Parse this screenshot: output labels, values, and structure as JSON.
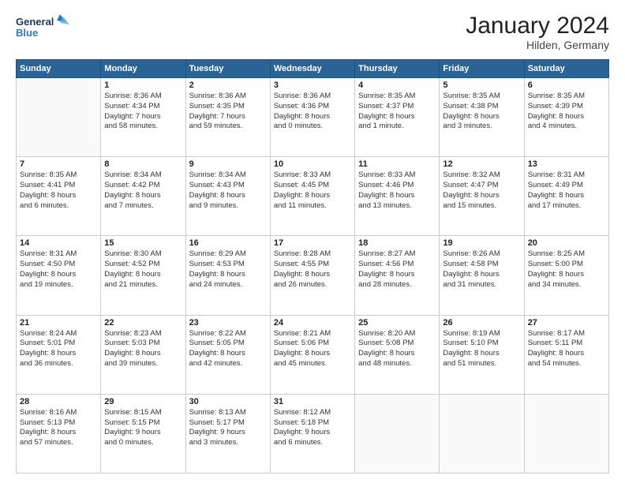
{
  "header": {
    "logo_line1": "General",
    "logo_line2": "Blue",
    "title": "January 2024",
    "subtitle": "Hilden, Germany"
  },
  "days_of_week": [
    "Sunday",
    "Monday",
    "Tuesday",
    "Wednesday",
    "Thursday",
    "Friday",
    "Saturday"
  ],
  "weeks": [
    [
      {
        "day": "",
        "info": ""
      },
      {
        "day": "1",
        "info": "Sunrise: 8:36 AM\nSunset: 4:34 PM\nDaylight: 7 hours\nand 58 minutes."
      },
      {
        "day": "2",
        "info": "Sunrise: 8:36 AM\nSunset: 4:35 PM\nDaylight: 7 hours\nand 59 minutes."
      },
      {
        "day": "3",
        "info": "Sunrise: 8:36 AM\nSunset: 4:36 PM\nDaylight: 8 hours\nand 0 minutes."
      },
      {
        "day": "4",
        "info": "Sunrise: 8:35 AM\nSunset: 4:37 PM\nDaylight: 8 hours\nand 1 minute."
      },
      {
        "day": "5",
        "info": "Sunrise: 8:35 AM\nSunset: 4:38 PM\nDaylight: 8 hours\nand 3 minutes."
      },
      {
        "day": "6",
        "info": "Sunrise: 8:35 AM\nSunset: 4:39 PM\nDaylight: 8 hours\nand 4 minutes."
      }
    ],
    [
      {
        "day": "7",
        "info": "Sunrise: 8:35 AM\nSunset: 4:41 PM\nDaylight: 8 hours\nand 6 minutes."
      },
      {
        "day": "8",
        "info": "Sunrise: 8:34 AM\nSunset: 4:42 PM\nDaylight: 8 hours\nand 7 minutes."
      },
      {
        "day": "9",
        "info": "Sunrise: 8:34 AM\nSunset: 4:43 PM\nDaylight: 8 hours\nand 9 minutes."
      },
      {
        "day": "10",
        "info": "Sunrise: 8:33 AM\nSunset: 4:45 PM\nDaylight: 8 hours\nand 11 minutes."
      },
      {
        "day": "11",
        "info": "Sunrise: 8:33 AM\nSunset: 4:46 PM\nDaylight: 8 hours\nand 13 minutes."
      },
      {
        "day": "12",
        "info": "Sunrise: 8:32 AM\nSunset: 4:47 PM\nDaylight: 8 hours\nand 15 minutes."
      },
      {
        "day": "13",
        "info": "Sunrise: 8:31 AM\nSunset: 4:49 PM\nDaylight: 8 hours\nand 17 minutes."
      }
    ],
    [
      {
        "day": "14",
        "info": "Sunrise: 8:31 AM\nSunset: 4:50 PM\nDaylight: 8 hours\nand 19 minutes."
      },
      {
        "day": "15",
        "info": "Sunrise: 8:30 AM\nSunset: 4:52 PM\nDaylight: 8 hours\nand 21 minutes."
      },
      {
        "day": "16",
        "info": "Sunrise: 8:29 AM\nSunset: 4:53 PM\nDaylight: 8 hours\nand 24 minutes."
      },
      {
        "day": "17",
        "info": "Sunrise: 8:28 AM\nSunset: 4:55 PM\nDaylight: 8 hours\nand 26 minutes."
      },
      {
        "day": "18",
        "info": "Sunrise: 8:27 AM\nSunset: 4:56 PM\nDaylight: 8 hours\nand 28 minutes."
      },
      {
        "day": "19",
        "info": "Sunrise: 8:26 AM\nSunset: 4:58 PM\nDaylight: 8 hours\nand 31 minutes."
      },
      {
        "day": "20",
        "info": "Sunrise: 8:25 AM\nSunset: 5:00 PM\nDaylight: 8 hours\nand 34 minutes."
      }
    ],
    [
      {
        "day": "21",
        "info": "Sunrise: 8:24 AM\nSunset: 5:01 PM\nDaylight: 8 hours\nand 36 minutes."
      },
      {
        "day": "22",
        "info": "Sunrise: 8:23 AM\nSunset: 5:03 PM\nDaylight: 8 hours\nand 39 minutes."
      },
      {
        "day": "23",
        "info": "Sunrise: 8:22 AM\nSunset: 5:05 PM\nDaylight: 8 hours\nand 42 minutes."
      },
      {
        "day": "24",
        "info": "Sunrise: 8:21 AM\nSunset: 5:06 PM\nDaylight: 8 hours\nand 45 minutes."
      },
      {
        "day": "25",
        "info": "Sunrise: 8:20 AM\nSunset: 5:08 PM\nDaylight: 8 hours\nand 48 minutes."
      },
      {
        "day": "26",
        "info": "Sunrise: 8:19 AM\nSunset: 5:10 PM\nDaylight: 8 hours\nand 51 minutes."
      },
      {
        "day": "27",
        "info": "Sunrise: 8:17 AM\nSunset: 5:11 PM\nDaylight: 8 hours\nand 54 minutes."
      }
    ],
    [
      {
        "day": "28",
        "info": "Sunrise: 8:16 AM\nSunset: 5:13 PM\nDaylight: 8 hours\nand 57 minutes."
      },
      {
        "day": "29",
        "info": "Sunrise: 8:15 AM\nSunset: 5:15 PM\nDaylight: 9 hours\nand 0 minutes."
      },
      {
        "day": "30",
        "info": "Sunrise: 8:13 AM\nSunset: 5:17 PM\nDaylight: 9 hours\nand 3 minutes."
      },
      {
        "day": "31",
        "info": "Sunrise: 8:12 AM\nSunset: 5:18 PM\nDaylight: 9 hours\nand 6 minutes."
      },
      {
        "day": "",
        "info": ""
      },
      {
        "day": "",
        "info": ""
      },
      {
        "day": "",
        "info": ""
      }
    ]
  ]
}
